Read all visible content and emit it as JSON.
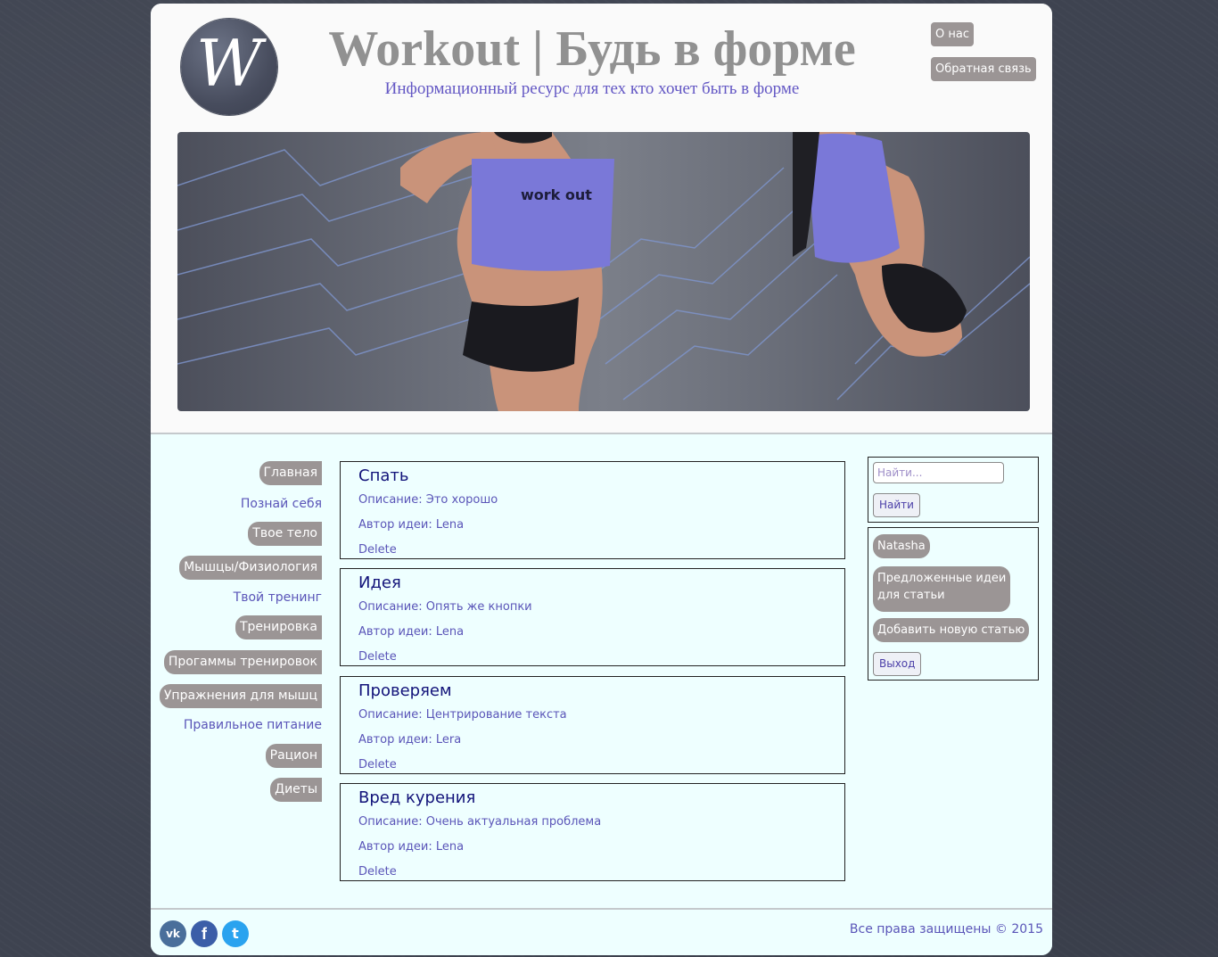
{
  "colors": {
    "background": "#3e4350",
    "panel": "#eeffff",
    "header": "#fafafa",
    "button_gray": "#9b9595",
    "link_purple": "#5a55b8",
    "title_navy": "#12137a",
    "title_gray": "#919191"
  },
  "header": {
    "logo_letter": "W",
    "title": "Workout | Будь в форме",
    "subtitle": "Информационный ресурс для тех кто хочет быть в форме",
    "about_btn": "О нас",
    "feedback_btn": "Обратная связь",
    "hero_shirt_text": "work out"
  },
  "nav": {
    "items": [
      {
        "label": "Главная",
        "style": "button"
      },
      {
        "label": "Познай себя",
        "style": "link"
      },
      {
        "label": "Твое тело",
        "style": "button"
      },
      {
        "label": "Мышцы/Физиология",
        "style": "button"
      },
      {
        "label": "Твой тренинг",
        "style": "link"
      },
      {
        "label": "Тренировка",
        "style": "button"
      },
      {
        "label": "Прогаммы тренировок",
        "style": "button"
      },
      {
        "label": "Упражнения для мышц",
        "style": "button"
      },
      {
        "label": "Правильное питание",
        "style": "link"
      },
      {
        "label": "Рацион",
        "style": "button"
      },
      {
        "label": "Диеты",
        "style": "button"
      }
    ]
  },
  "articles": [
    {
      "title": "Спать",
      "description": "Описание: Это хорошо",
      "author": "Автор идеи: Lena",
      "delete": "Delete"
    },
    {
      "title": "Идея",
      "description": "Описание: Опять же кнопки",
      "author": "Автор идеи: Lena",
      "delete": "Delete"
    },
    {
      "title": "Проверяем",
      "description": "Описание: Центрирование текста",
      "author": "Автор идеи: Lera",
      "delete": "Delete"
    },
    {
      "title": "Вред курения",
      "description": "Описание: Очень актуальная проблема",
      "author": "Автор идеи: Lena",
      "delete": "Delete"
    }
  ],
  "sidebar": {
    "search_placeholder": "Найти...",
    "search_btn": "Найти",
    "username": "Natasha",
    "proposed_line1": "Предложенные идеи",
    "proposed_line2": "для статьи",
    "add_article_btn": "Добавить новую статью",
    "logout_btn": "Выход"
  },
  "footer": {
    "social": [
      {
        "name": "vk",
        "glyph": "vk",
        "color": "#4a6f9b"
      },
      {
        "name": "facebook",
        "glyph": "f",
        "color": "#3b5ea8"
      },
      {
        "name": "twitter",
        "glyph": "t",
        "color": "#2aa3ef"
      }
    ],
    "copyright": "Все права защищены © 2015"
  }
}
